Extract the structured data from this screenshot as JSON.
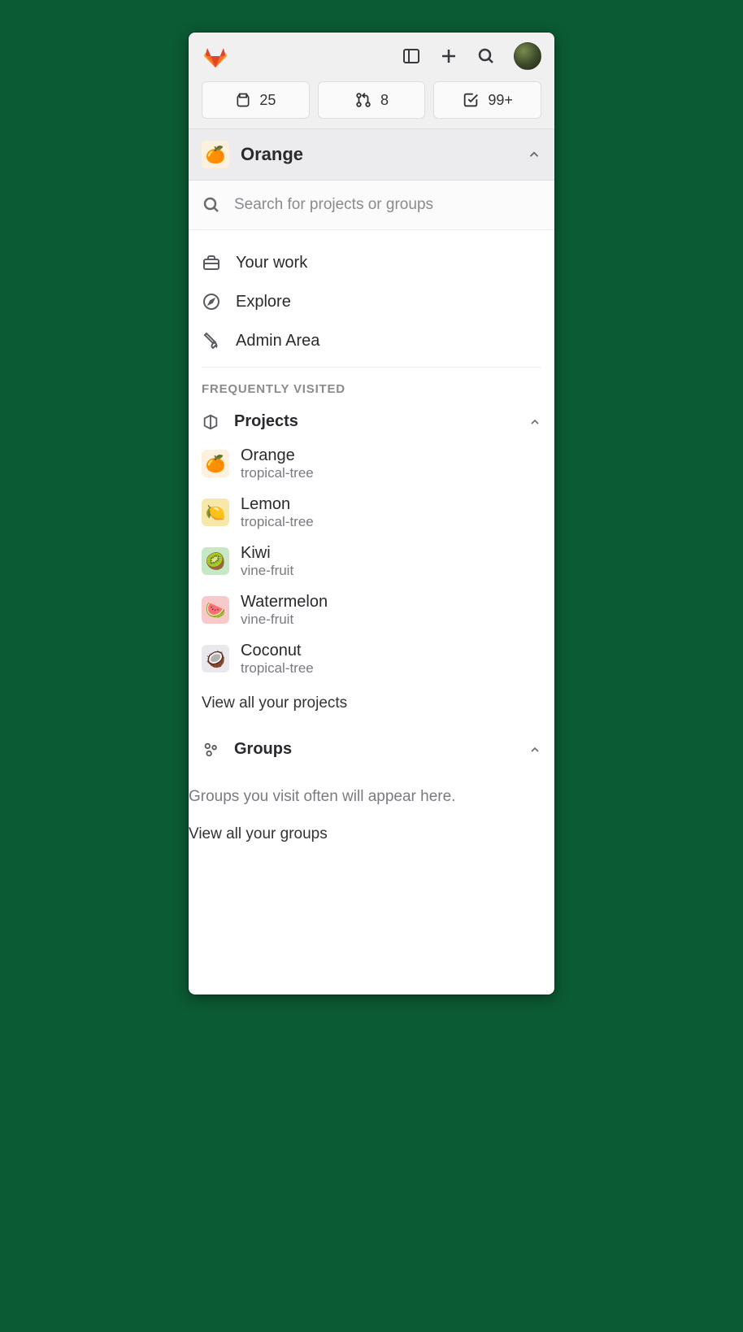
{
  "topbar": {
    "counters": {
      "issues": "25",
      "merge_requests": "8",
      "todos": "99+"
    }
  },
  "context": {
    "title": "Orange",
    "icon": "🍊"
  },
  "search": {
    "placeholder": "Search for projects or groups"
  },
  "nav": {
    "your_work": "Your work",
    "explore": "Explore",
    "admin": "Admin Area"
  },
  "frequently_visited": {
    "eyebrow": "FREQUENTLY VISITED",
    "projects_title": "Projects",
    "groups_title": "Groups",
    "projects": [
      {
        "name": "Orange",
        "sub": "tropical-tree",
        "icon": "🍊",
        "badge": "badge-orange"
      },
      {
        "name": "Lemon",
        "sub": "tropical-tree",
        "icon": "🍋",
        "badge": "badge-lemon"
      },
      {
        "name": "Kiwi",
        "sub": "vine-fruit",
        "icon": "🥝",
        "badge": "badge-kiwi"
      },
      {
        "name": "Watermelon",
        "sub": "vine-fruit",
        "icon": "🍉",
        "badge": "badge-melon"
      },
      {
        "name": "Coconut",
        "sub": "tropical-tree",
        "icon": "🥥",
        "badge": "badge-coco"
      }
    ],
    "view_all_projects": "View all your projects",
    "groups_empty": "Groups you visit often will appear here.",
    "view_all_groups": "View all your groups"
  }
}
